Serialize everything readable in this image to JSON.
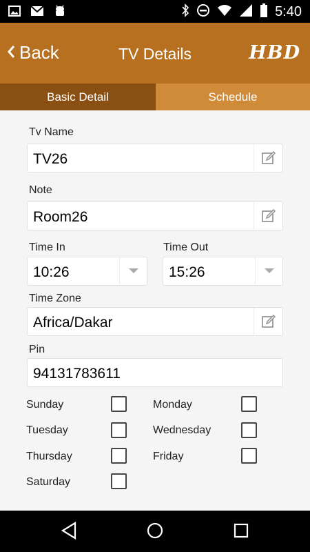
{
  "status_bar": {
    "time": "5:40"
  },
  "app_bar": {
    "back_label": "Back",
    "title": "TV Details",
    "logo": "HBD"
  },
  "tabs": [
    {
      "label": "Basic Detail",
      "active": true
    },
    {
      "label": "Schedule",
      "active": false
    }
  ],
  "form": {
    "tv_name": {
      "label": "Tv Name",
      "value": "TV26"
    },
    "note": {
      "label": "Note",
      "value": "Room26"
    },
    "time_in": {
      "label": "Time In",
      "value": "10:26"
    },
    "time_out": {
      "label": "Time Out",
      "value": "15:26"
    },
    "time_zone": {
      "label": "Time Zone",
      "value": "Africa/Dakar"
    },
    "pin": {
      "label": "Pin",
      "value": "94131783611"
    }
  },
  "days": [
    {
      "label": "Sunday",
      "checked": false
    },
    {
      "label": "Monday",
      "checked": false
    },
    {
      "label": "Tuesday",
      "checked": false
    },
    {
      "label": "Wednesday",
      "checked": false
    },
    {
      "label": "Thursday",
      "checked": false
    },
    {
      "label": "Friday",
      "checked": false
    },
    {
      "label": "Saturday",
      "checked": false
    }
  ],
  "colors": {
    "app_bar": "#b7701f",
    "tab_active": "#8a4f13",
    "tab_inactive": "#d08b39"
  }
}
